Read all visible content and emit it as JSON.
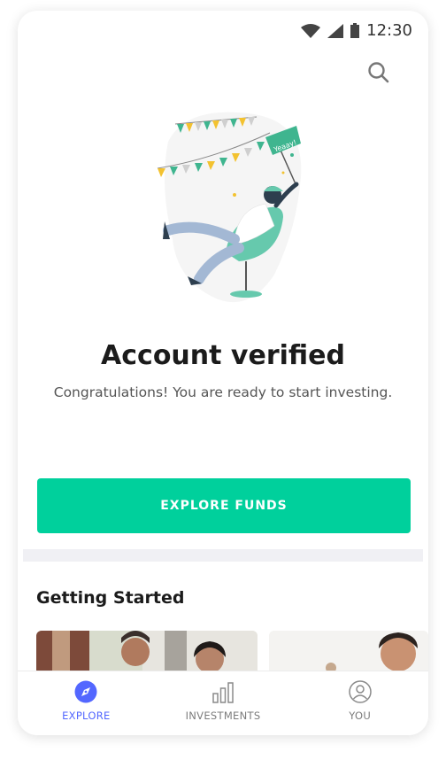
{
  "status_bar": {
    "time": "12:30",
    "icons": [
      "wifi-icon",
      "signal-icon",
      "battery-icon"
    ]
  },
  "header": {
    "search_icon": "search-icon"
  },
  "illustration": {
    "flag_text": "Yeaay!",
    "colors": {
      "seat": "#66c9ad",
      "bunting_green": "#3fb58f",
      "bunting_yellow": "#f3c230"
    }
  },
  "main": {
    "title": "Account verified",
    "subtitle": "Congratulations! You are ready to start investing.",
    "cta_label": "EXPLORE FUNDS"
  },
  "getting_started": {
    "title": "Getting Started"
  },
  "bottom_nav": {
    "items": [
      {
        "label": "EXPLORE",
        "icon": "compass-icon",
        "active": true
      },
      {
        "label": "INVESTMENTS",
        "icon": "bar-chart-icon",
        "active": false
      },
      {
        "label": "YOU",
        "icon": "user-icon",
        "active": false
      }
    ]
  },
  "colors": {
    "accent": "#00d09c",
    "nav_active": "#5367ff"
  }
}
